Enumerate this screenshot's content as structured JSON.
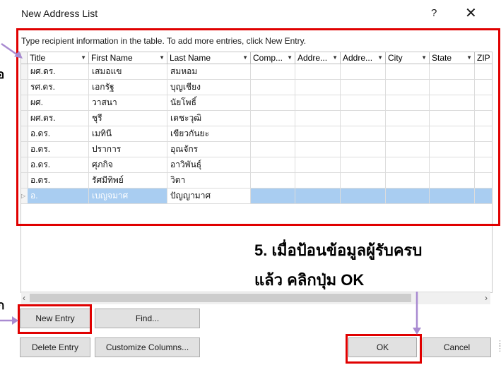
{
  "window": {
    "title": "New Address List",
    "help": "?",
    "close": "✕"
  },
  "instructions": "Type recipient information in the table.  To add more entries, click New Entry.",
  "columns": [
    "Title",
    "First Name",
    "Last Name",
    "Comp...",
    "Addre...",
    "Addre...",
    "City",
    "State",
    "ZIP"
  ],
  "rows": [
    [
      "ผศ.ดร.",
      "เสมอแข",
      "สมหอม"
    ],
    [
      "รศ.ดร.",
      "เอกรัฐ",
      "บุญเชียง"
    ],
    [
      "ผศ.",
      "วาสนา",
      "นัยโพธิ์"
    ],
    [
      "ผศ.ดร.",
      "ชุรี",
      "เตชะวุฒิ"
    ],
    [
      "อ.ดร.",
      "เมทินี",
      "เขียวกันยะ"
    ],
    [
      "อ.ดร.",
      "ปราการ",
      "อุณจักร"
    ],
    [
      "อ.ดร.",
      "ศุภกิจ",
      "อาวิพันธุ์"
    ],
    [
      "อ.ดร.",
      "รัศมีทิพย์",
      "วิตา"
    ],
    [
      "อ.",
      "เบญจมาศ",
      "ปัญญามาศ"
    ]
  ],
  "buttons": {
    "new_entry": "New Entry",
    "find": "Find...",
    "delete_entry": "Delete Entry",
    "customize_columns": "Customize Columns...",
    "ok": "OK",
    "cancel": "Cancel"
  },
  "annotation": {
    "line1": "5. เมื่อป้อนข้อมูลผู้รับครบ",
    "line2": "แล้ว คลิกปุ่ม OK",
    "left_edge_1": "อ",
    "left_edge_2": "ก"
  },
  "colors": {
    "highlight": "#e00000",
    "arrow": "#a98bd1",
    "selected_row": "#a9cdf1"
  }
}
